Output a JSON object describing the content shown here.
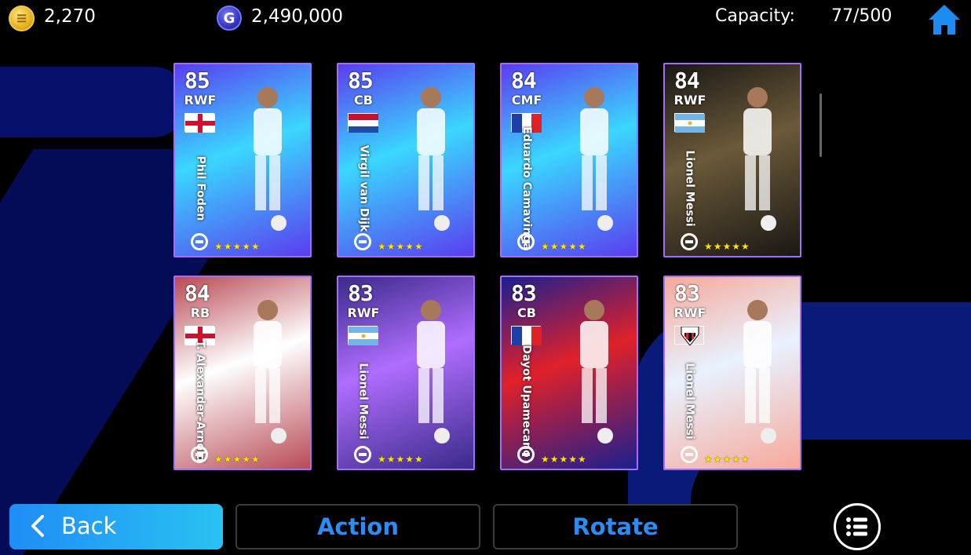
{
  "header": {
    "coins": "2,270",
    "gp": "2,490,000",
    "capacity_label": "Capacity:",
    "capacity_value": "77/500"
  },
  "cards": [
    {
      "rating": "85",
      "position": "RWF",
      "name": "Phil Foden",
      "flag": "england",
      "bg": "#5a3df0",
      "accent": "#3ad7ff"
    },
    {
      "rating": "85",
      "position": "CB",
      "name": "Virgil van Dijk",
      "flag": "netherlands",
      "bg": "#5a3df0",
      "accent": "#3ad7ff"
    },
    {
      "rating": "84",
      "position": "CMF",
      "name": "Eduardo Camavinga",
      "flag": "france",
      "bg": "#5a3df0",
      "accent": "#3ad7ff"
    },
    {
      "rating": "84",
      "position": "RWF",
      "name": "Lionel Messi",
      "flag": "argentina",
      "bg": "#1a1714",
      "accent": "#6b5a3a"
    },
    {
      "rating": "84",
      "position": "RB",
      "name": "T. Alexander-Arnold",
      "flag": "england",
      "bg": "#b94a55",
      "accent": "#ffffff"
    },
    {
      "rating": "83",
      "position": "RWF",
      "name": "Lionel Messi",
      "flag": "argentina",
      "bg": "#3a2a8a",
      "accent": "#b06dff"
    },
    {
      "rating": "83",
      "position": "CB",
      "name": "Dayot Upamecano",
      "flag": "france",
      "bg": "#1b1f8f",
      "accent": "#e0212a"
    },
    {
      "rating": "83",
      "position": "RWF",
      "name": "Lionel Messi",
      "flag": "saopaulo",
      "bg": "#f7a89a",
      "accent": "#e8f2ff"
    }
  ],
  "stars": "★★★★★",
  "buttons": {
    "back": "Back",
    "action": "Action",
    "rotate": "Rotate"
  },
  "colors": {
    "accent_blue": "#2b8cf3",
    "card_border": "#a46bff"
  }
}
